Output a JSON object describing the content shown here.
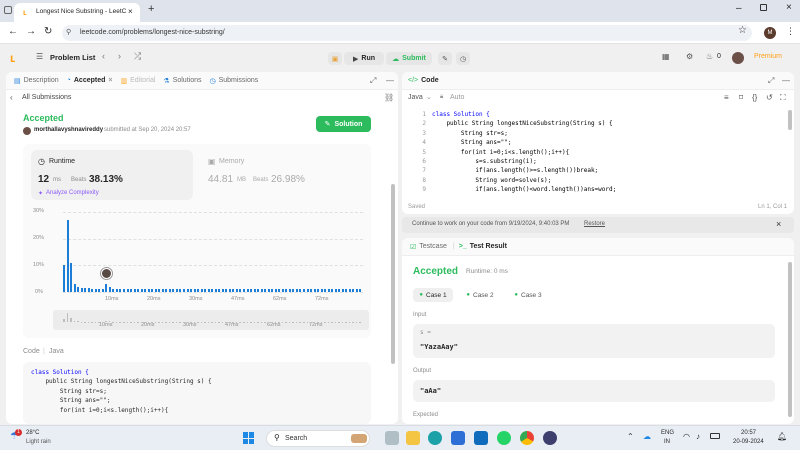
{
  "browser": {
    "tab_title": "Longest Nice Substring - LeetC",
    "url": "leetcode.com/problems/longest-nice-substring/",
    "profile_initial": "M"
  },
  "nav": {
    "problem_list": "Problem List",
    "run": "Run",
    "submit": "Submit",
    "streak": "0",
    "premium": "Premium"
  },
  "left_tabs": {
    "description": "Description",
    "accepted": "Accepted",
    "editorial": "Editorial",
    "solutions": "Solutions",
    "submissions": "Submissions"
  },
  "submission": {
    "back": "All Submissions",
    "status": "Accepted",
    "user": "morthallavyshnavireddy",
    "submitted": "submitted at Sep 20, 2024 20:57",
    "solution_btn": "Solution",
    "runtime_label": "Runtime",
    "runtime_value": "12",
    "runtime_unit": "ms",
    "beats_label": "Beats",
    "runtime_beats": "38.13%",
    "analyze": "Analyze Complexity",
    "memory_label": "Memory",
    "memory_value": "44.81",
    "memory_unit": "MB",
    "memory_beats_label": "Beats",
    "memory_beats": "26.98%"
  },
  "chart_data": {
    "type": "bar",
    "y_ticks": [
      "30%",
      "20%",
      "10%",
      "0%"
    ],
    "ylim": [
      0,
      30
    ],
    "x_ticks": [
      "10ms",
      "20ms",
      "30ms",
      "47ms",
      "62ms",
      "72ms"
    ],
    "values": [
      10,
      27,
      11,
      3,
      2,
      1.5,
      1.5,
      1.5,
      1,
      1,
      1,
      1,
      3,
      2,
      1,
      1,
      1,
      1,
      1,
      1,
      1,
      1,
      1,
      1,
      1,
      1,
      1,
      1,
      1,
      1,
      1,
      1,
      1,
      1,
      1,
      1,
      1,
      1,
      1,
      1,
      1,
      1,
      1,
      1,
      1,
      1,
      1,
      1,
      1,
      1,
      1,
      1,
      1,
      1,
      1,
      1,
      1,
      1,
      1,
      1,
      1,
      1,
      1,
      1,
      1,
      1,
      1,
      1,
      1,
      1,
      1,
      1,
      1,
      1,
      1,
      1,
      1,
      1,
      1,
      1,
      1,
      1,
      1,
      1,
      1
    ],
    "highlight_index": 12,
    "mini_ticks": [
      "10ms",
      "20ms",
      "30ms",
      "47ms",
      "62ms",
      "72ms"
    ]
  },
  "left_code": {
    "header": "Code",
    "lang": "Java",
    "lines": [
      "class Solution {",
      "    public String longestNiceSubstring(String s) {",
      "        String str=s;",
      "        String ans=\"\";",
      "        for(int i=0;i<s.length();i++){"
    ]
  },
  "editor": {
    "title": "Code",
    "lang": "Java",
    "mode": "Auto",
    "line_numbers": [
      "1",
      "2",
      "3",
      "4",
      "5",
      "6",
      "7",
      "8",
      "9"
    ],
    "lines": [
      "class Solution {",
      "    public String longestNiceSubstring(String s) {",
      "        String str=s;",
      "        String ans=\"\";",
      "        for(int i=0;i<s.length();i++){",
      "            s=s.substring(i);",
      "            if(ans.length()>=s.length())break;",
      "            String word=solve(s);",
      "            if(ans.length()<word.length())ans=word;"
    ],
    "saved": "Saved",
    "position": "Ln 1, Col 1",
    "restore_msg": "Continue to work on your code from 9/19/2024, 9:40:03 PM",
    "restore": "Restore"
  },
  "result": {
    "testcase_tab": "Testcase",
    "result_tab": "Test Result",
    "status": "Accepted",
    "runtime": "Runtime: 0 ms",
    "cases": [
      "Case 1",
      "Case 2",
      "Case 3"
    ],
    "input_label": "Input",
    "input_var": "s =",
    "input_value": "\"YazaAay\"",
    "output_label": "Output",
    "output_value": "\"aAa\"",
    "expected_label": "Expected"
  },
  "taskbar": {
    "weather_temp": "28°C",
    "weather_desc": "Light rain",
    "search": "Search",
    "lang1": "ENG",
    "lang2": "IN",
    "time": "20:57",
    "date": "20-09-2024",
    "badge": "1"
  },
  "colors": {
    "accent_green": "#2cbb5d",
    "premium": "#ffa116",
    "bar_blue": "#1d7ed8"
  }
}
